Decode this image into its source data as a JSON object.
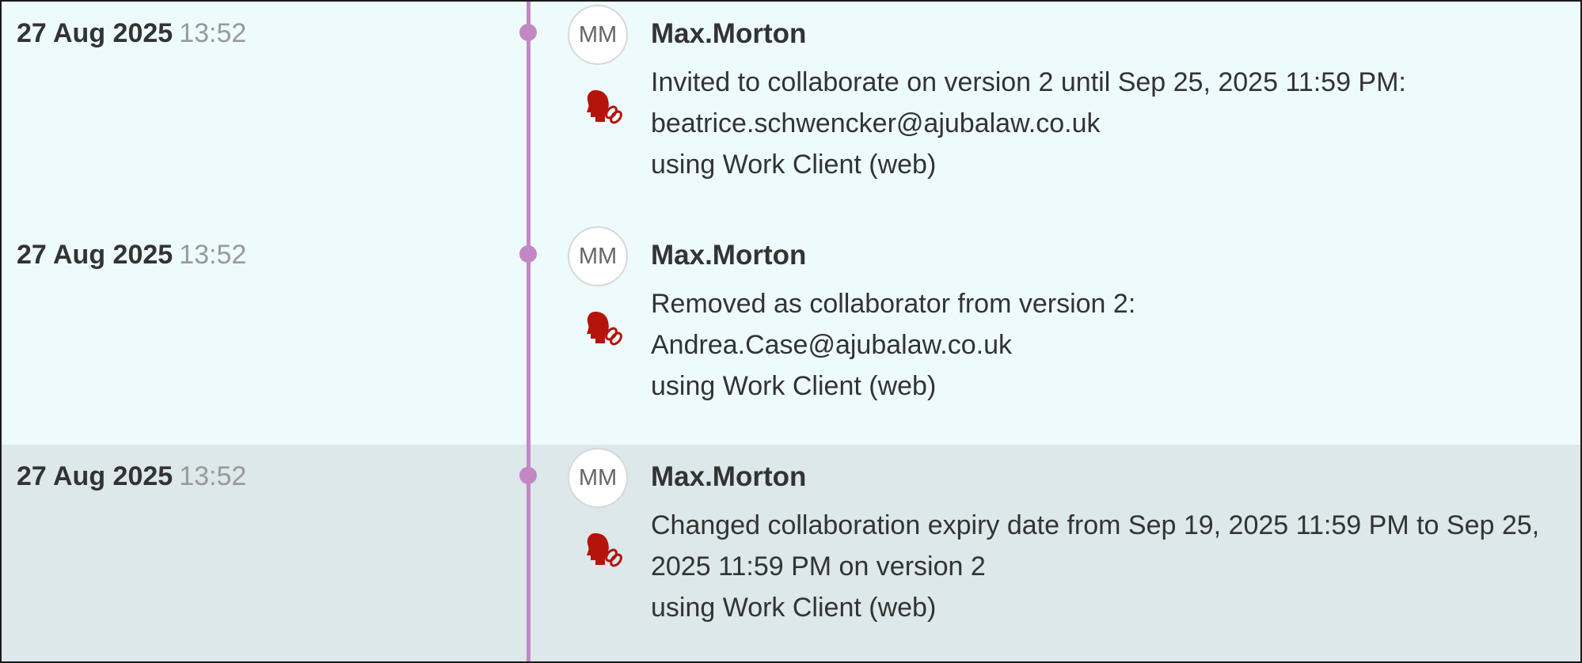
{
  "colors": {
    "timeline": "#c388c4",
    "row_background": "#eefbfd",
    "selected_row_background": "#dce8ea",
    "collab_icon": "#b5140c"
  },
  "entries": [
    {
      "date": "27 Aug 2025",
      "time": "13:52",
      "avatar_initials": "MM",
      "icon": "collaborator-link-icon",
      "user": "Max.Morton",
      "lines": [
        "Invited to collaborate on version 2 until Sep 25, 2025 11:59 PM:",
        "beatrice.schwencker@ajubalaw.co.uk",
        "using Work Client (web)"
      ]
    },
    {
      "date": "27 Aug 2025",
      "time": "13:52",
      "avatar_initials": "MM",
      "icon": "collaborator-link-icon",
      "user": "Max.Morton",
      "lines": [
        "Removed as collaborator from version 2:",
        "Andrea.Case@ajubalaw.co.uk",
        "using Work Client (web)"
      ]
    },
    {
      "date": "27 Aug 2025",
      "time": "13:52",
      "avatar_initials": "MM",
      "icon": "collaborator-link-icon",
      "user": "Max.Morton",
      "lines": [
        "Changed collaboration expiry date from Sep 19, 2025 11:59 PM to Sep 25, 2025 11:59 PM on version 2",
        "using Work Client (web)"
      ]
    }
  ]
}
